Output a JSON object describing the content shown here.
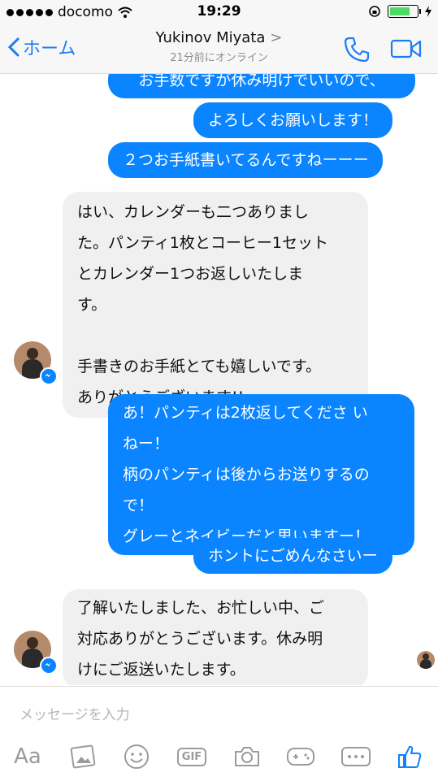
{
  "status_bar": {
    "carrier": "docomo",
    "time": "19:29"
  },
  "header": {
    "back_label": "ホーム",
    "contact_name": "Yukinov Miyata",
    "presence": "21分前にオンライン"
  },
  "messages": [
    {
      "from": "me",
      "text": "お手数ですが休み明けでいいので、"
    },
    {
      "from": "me",
      "text": "よろしくお願いします！"
    },
    {
      "from": "me",
      "text": "２つお手紙書いてるんですねーーー"
    },
    {
      "from": "them",
      "text": "はい、カレンダーも二つありまし\nた。パンティ1枚とコーヒー1セット\nとカレンダー1つお返しいたしま\nす。\n\n手書きのお手紙とても嬉しいです。\nありがとうございます!!"
    },
    {
      "from": "me",
      "text": "あ！パンティは2枚返してくださ い\nねー！\n柄のパンティは後からお送りするの\nで！\nグレーとネイビーだと思いますー！"
    },
    {
      "from": "me",
      "text": "ホントにごめんなさいー"
    },
    {
      "from": "them",
      "text": "了解いたしました、お忙しい中、ご\n対応ありがとうございます。休み明\nけにご返送いたします。"
    }
  ],
  "composer": {
    "placeholder": "メッセージを入力",
    "aa_label": "Aa",
    "gif_label": "GIF"
  },
  "colors": {
    "accent": "#0a84ff",
    "incoming": "#f0f0f0"
  }
}
